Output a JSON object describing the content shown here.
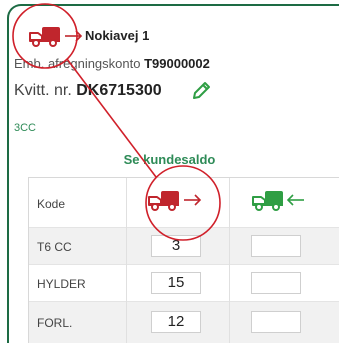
{
  "header": {
    "title": "Nokiavej 1"
  },
  "account": {
    "label": "Emb. afregningskonto",
    "number": "T99000002"
  },
  "receipt": {
    "label": "Kvitt. nr.",
    "number": "DK6715300"
  },
  "route_code": "3CC",
  "saldo_link": "Se kundesaldo",
  "table": {
    "header_label": "Kode",
    "rows": [
      {
        "code": "T6 CC",
        "delivered": "3",
        "returned": ""
      },
      {
        "code": "HYLDER",
        "delivered": "15",
        "returned": ""
      },
      {
        "code": "FORL.",
        "delivered": "12",
        "returned": ""
      }
    ]
  },
  "colors": {
    "brand_green": "#1d6b44",
    "link_green": "#2e8b57",
    "truck_red": "#c0262d",
    "truck_green": "#2f9e44",
    "callout_red": "#d0202a"
  },
  "icons": {
    "header": "delivery-truck-outgoing-icon",
    "edit": "pencil-icon",
    "delivered_col": "delivery-truck-outgoing-icon",
    "returned_col": "return-truck-incoming-icon"
  }
}
